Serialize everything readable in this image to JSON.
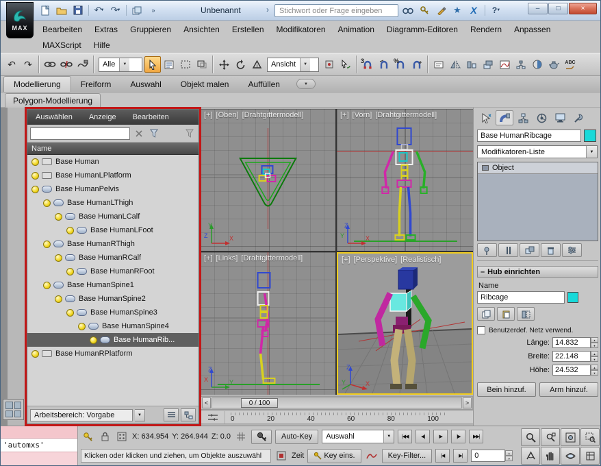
{
  "glyphs": {
    "undo": "↶",
    "redo": "↷",
    "dropdown": "▼",
    "chevron": "›",
    "minimize": "–",
    "maximize": "□",
    "close": "×",
    "star": "★",
    "x_mark": "X",
    "help": "?",
    "minus": "–"
  },
  "titlebar": {
    "logo_text": "MAX",
    "title": "Unbenannt",
    "search_placeholder": "Stichwort oder Frage eingeben"
  },
  "menubar": {
    "row1": [
      "Bearbeiten",
      "Extras",
      "Gruppieren",
      "Ansichten",
      "Erstellen",
      "Modifikatoren",
      "Animation",
      "Diagramm-Editoren",
      "Rendern",
      "Anpassen"
    ],
    "row2": [
      "MAXScript",
      "Hilfe"
    ]
  },
  "toolbar": {
    "filter_value": "Alle",
    "coord_value": "Ansicht",
    "snap_label": "3",
    "percent_label": "%",
    "abc_label": "ABC"
  },
  "ribbon": {
    "tabs": [
      "Modellierung",
      "Freiform",
      "Auswahl",
      "Objekt malen",
      "Auffüllen"
    ],
    "subtab": "Polygon-Modellierung"
  },
  "scene_explorer": {
    "menu": [
      "Auswählen",
      "Anzeige",
      "Bearbeiten"
    ],
    "header": "Name",
    "rows": [
      {
        "label": "Base Human",
        "indent": 0,
        "icon": "dummy"
      },
      {
        "label": "Base HumanLPlatform",
        "indent": 0,
        "icon": "dummy"
      },
      {
        "label": "Base HumanPelvis",
        "indent": 0,
        "icon": "bone"
      },
      {
        "label": "Base HumanLThigh",
        "indent": 1,
        "icon": "bone"
      },
      {
        "label": "Base HumanLCalf",
        "indent": 2,
        "icon": "bone"
      },
      {
        "label": "Base HumanLFoot",
        "indent": 3,
        "icon": "bone"
      },
      {
        "label": "Base HumanRThigh",
        "indent": 1,
        "icon": "bone"
      },
      {
        "label": "Base HumanRCalf",
        "indent": 2,
        "icon": "bone"
      },
      {
        "label": "Base HumanRFoot",
        "indent": 3,
        "icon": "bone"
      },
      {
        "label": "Base HumanSpine1",
        "indent": 1,
        "icon": "bone"
      },
      {
        "label": "Base HumanSpine2",
        "indent": 2,
        "icon": "bone"
      },
      {
        "label": "Base HumanSpine3",
        "indent": 3,
        "icon": "bone"
      },
      {
        "label": "Base HumanSpine4",
        "indent": 4,
        "icon": "bone"
      },
      {
        "label": "Base HumanRib...",
        "indent": 5,
        "icon": "bone",
        "selected": true
      },
      {
        "label": "Base HumanRPlatform",
        "indent": 0,
        "icon": "dummy"
      }
    ],
    "workspace": "Arbeitsbereich: Vorgabe"
  },
  "viewports": {
    "top_left": {
      "plus": "[+]",
      "view": "[Oben]",
      "shading": "[Drahtgittermodell]"
    },
    "top_right": {
      "plus": "[+]",
      "view": "[Vorn]",
      "shading": "[Drahtgittermodell]"
    },
    "bottom_left": {
      "plus": "[+]",
      "view": "[Links]",
      "shading": "[Drahtgittermodell]"
    },
    "bottom_right": {
      "plus": "[+]",
      "view": "[Perspektive]",
      "shading": "[Realistisch]"
    }
  },
  "axes": {
    "x": "X",
    "y": "Y",
    "z": "Z"
  },
  "timeline": {
    "slider_label": "0 / 100",
    "prev": "<",
    "next": ">",
    "ticks": [
      "0",
      "20",
      "40",
      "60",
      "80",
      "100"
    ]
  },
  "command_panel": {
    "object_name": "Base HumanRibcage",
    "modifier_list": "Modifikatoren-Liste",
    "stack_item": "Object",
    "rollout_title": "Hub einrichten",
    "name_label": "Name",
    "name_value": "Ribcage",
    "use_custom_mesh": "Benutzerdef. Netz verwend.",
    "length_label": "Länge:",
    "length_value": "14.832",
    "width_label": "Breite:",
    "width_value": "22.148",
    "height_label": "Höhe:",
    "height_value": "24.532",
    "add_leg": "Bein hinzuf.",
    "add_arm": "Arm hinzuf."
  },
  "statusbar": {
    "listener_text": "'automxs'",
    "prompt": "Klicken oder klicken und ziehen, um Objekte auszuwähl",
    "x_label": "X:",
    "x_value": "634.954",
    "y_label": "Y:",
    "y_value": "264.944",
    "z_label": "Z:",
    "z_value": "0.0",
    "autokey": "Auto-Key",
    "selection_mode": "Auswahl",
    "zeit": "Zeit",
    "key_ins": "Key eins.",
    "key_filter": "Key-Filter...",
    "frame": "0"
  },
  "transport": {
    "go_start": "|◀◀",
    "prev": "◀|",
    "play": "▶",
    "next": "|▶",
    "go_end": "▶▶|",
    "prev_frame": "|◀",
    "next_frame": "▶|"
  }
}
